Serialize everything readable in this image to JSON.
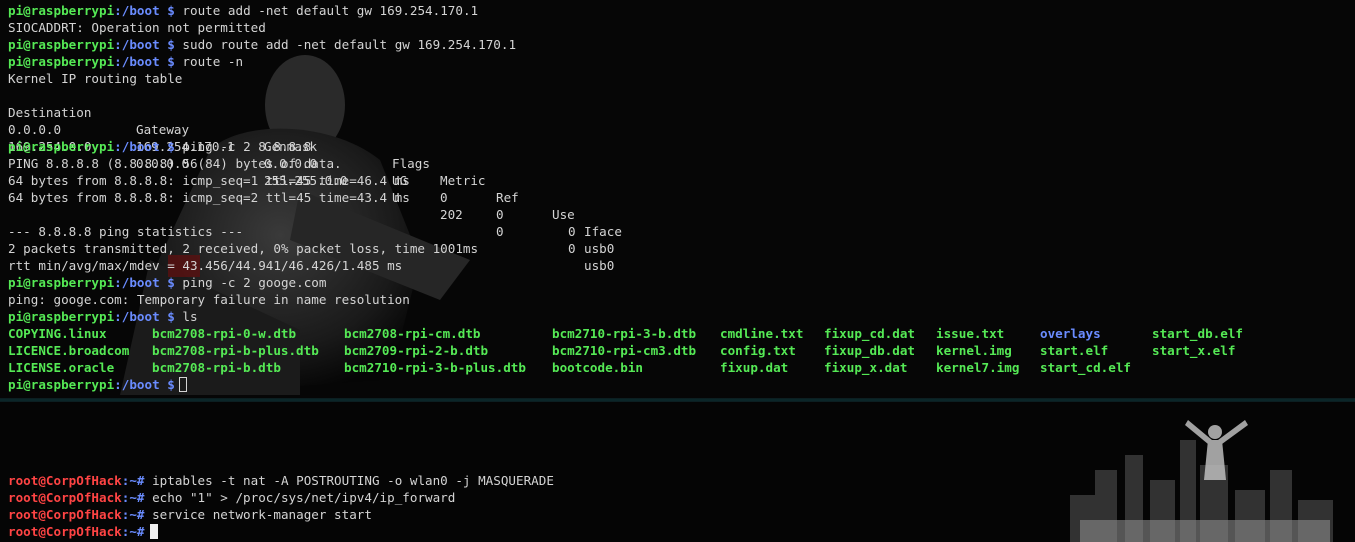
{
  "top_terminal": {
    "prompt_user": "pi@raspberrypi",
    "prompt_path": ":/boot $",
    "lines": [
      {
        "type": "cmd",
        "text": " route add -net default gw 169.254.170.1"
      },
      {
        "type": "out",
        "text": "SIOCADDRT: Operation not permitted"
      },
      {
        "type": "cmd",
        "text": " sudo route add -net default gw 169.254.170.1"
      },
      {
        "type": "cmd",
        "text": " route -n"
      },
      {
        "type": "out",
        "text": "Kernel IP routing table"
      }
    ],
    "routing_table": {
      "headers": [
        "Destination",
        "Gateway",
        "Genmask",
        "Flags",
        "Metric",
        "Ref",
        "Use",
        "Iface"
      ],
      "rows": [
        [
          "0.0.0.0",
          "169.254.170.1",
          "0.0.0.0",
          "UG",
          "0",
          "0",
          "0",
          "usb0"
        ],
        [
          "169.254.0.0",
          "0.0.0.0",
          "255.255.0.0",
          "U",
          "202",
          "0",
          "0",
          "usb0"
        ]
      ]
    },
    "ping_lines": [
      {
        "type": "cmd",
        "text": " ping -c 2 8.8.8.8"
      },
      {
        "type": "out",
        "text": "PING 8.8.8.8 (8.8.8.8) 56(84) bytes of data."
      },
      {
        "type": "out",
        "text": "64 bytes from 8.8.8.8: icmp_seq=1 ttl=45 time=46.4 ms"
      },
      {
        "type": "out",
        "text": "64 bytes from 8.8.8.8: icmp_seq=2 ttl=45 time=43.4 ms"
      },
      {
        "type": "out",
        "text": ""
      },
      {
        "type": "out",
        "text": "--- 8.8.8.8 ping statistics ---"
      },
      {
        "type": "out",
        "text": "2 packets transmitted, 2 received, 0% packet loss, time 1001ms"
      },
      {
        "type": "out",
        "text": "rtt min/avg/max/mdev = 43.456/44.941/46.426/1.485 ms"
      },
      {
        "type": "cmd",
        "text": " ping -c 2 googe.com"
      },
      {
        "type": "out",
        "text": "ping: googe.com: Temporary failure in name resolution"
      },
      {
        "type": "cmd",
        "text": " ls"
      }
    ],
    "ls_columns": [
      {
        "items": [
          "COPYING.linux",
          "LICENCE.broadcom",
          "LICENSE.oracle"
        ],
        "color": "green"
      },
      {
        "items": [
          "bcm2708-rpi-0-w.dtb",
          "bcm2708-rpi-b-plus.dtb",
          "bcm2708-rpi-b.dtb"
        ],
        "color": "green"
      },
      {
        "items": [
          "bcm2708-rpi-cm.dtb",
          "bcm2709-rpi-2-b.dtb",
          "bcm2710-rpi-3-b-plus.dtb"
        ],
        "color": "green"
      },
      {
        "items": [
          "bcm2710-rpi-3-b.dtb",
          "bcm2710-rpi-cm3.dtb",
          "bootcode.bin"
        ],
        "color": "green"
      },
      {
        "items": [
          "cmdline.txt",
          "config.txt",
          "fixup.dat"
        ],
        "color": "green"
      },
      {
        "items": [
          "fixup_cd.dat",
          "fixup_db.dat",
          "fixup_x.dat"
        ],
        "color": "green"
      },
      {
        "items": [
          "issue.txt",
          "kernel.img",
          "kernel7.img"
        ],
        "color": "green"
      },
      {
        "items": [
          "overlays",
          "start.elf",
          "start_cd.elf"
        ],
        "colors": [
          "blue",
          "green",
          "green"
        ]
      },
      {
        "items": [
          "start_db.elf",
          "start_x.elf",
          ""
        ],
        "color": "green"
      }
    ]
  },
  "bottom_terminal": {
    "prompt_user": "root@CorpOfHack",
    "prompt_sep": ":~#",
    "commands": [
      " iptables -t nat -A POSTROUTING -o wlan0 -j MASQUERADE",
      " echo \"1\" > /proc/sys/net/ipv4/ip_forward",
      " service network-manager start",
      ""
    ]
  },
  "colors": {
    "prompt_green": "#55e955",
    "prompt_blue": "#6a8cff",
    "prompt_red": "#ff4444",
    "text": "#d4d4d4",
    "background": "#050505"
  }
}
